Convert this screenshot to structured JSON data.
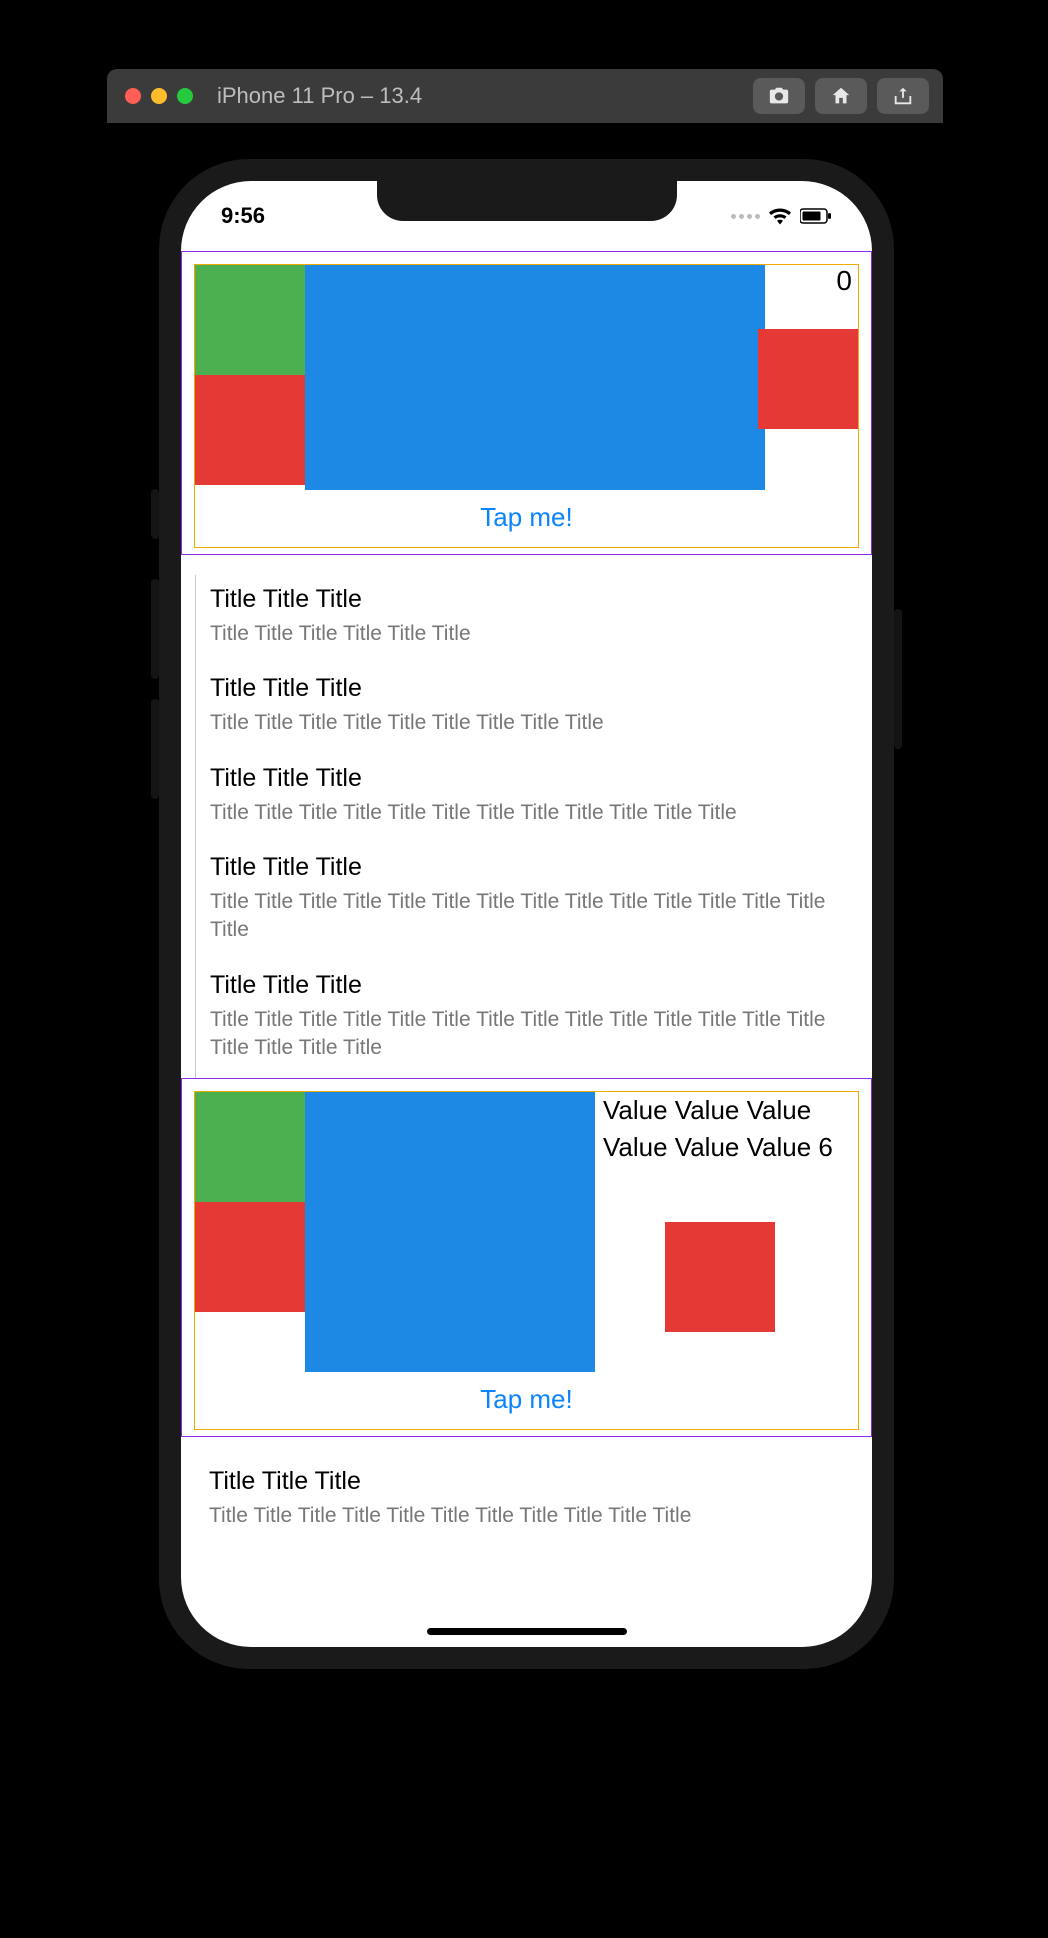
{
  "titlebar": {
    "title": "iPhone 11 Pro – 13.4"
  },
  "statusbar": {
    "time": "9:56"
  },
  "panel1": {
    "counter": "0",
    "tap_label": "Tap me!"
  },
  "list": [
    {
      "title": "Title Title Title",
      "subtitle": "Title Title Title  Title Title Title"
    },
    {
      "title": "Title Title Title",
      "subtitle": "Title Title Title  Title Title Title  Title Title Title"
    },
    {
      "title": "Title Title Title",
      "subtitle": "Title Title Title  Title Title Title  Title Title Title  Title Title Title"
    },
    {
      "title": "Title Title Title",
      "subtitle": "Title Title Title  Title Title Title  Title Title Title  Title Title Title  Title Title Title"
    },
    {
      "title": "Title Title Title",
      "subtitle": "Title Title Title  Title Title Title  Title Title Title  Title Title Title  Title Title Title  Title Title Title"
    }
  ],
  "panel2": {
    "value_label": "Value Value Value Value Value Value 6",
    "tap_label": "Tap me!"
  },
  "list_tail": {
    "title": "Title Title Title",
    "subtitle": "Title Title Title  Title Title Title  Title Title Title  Title Title"
  }
}
